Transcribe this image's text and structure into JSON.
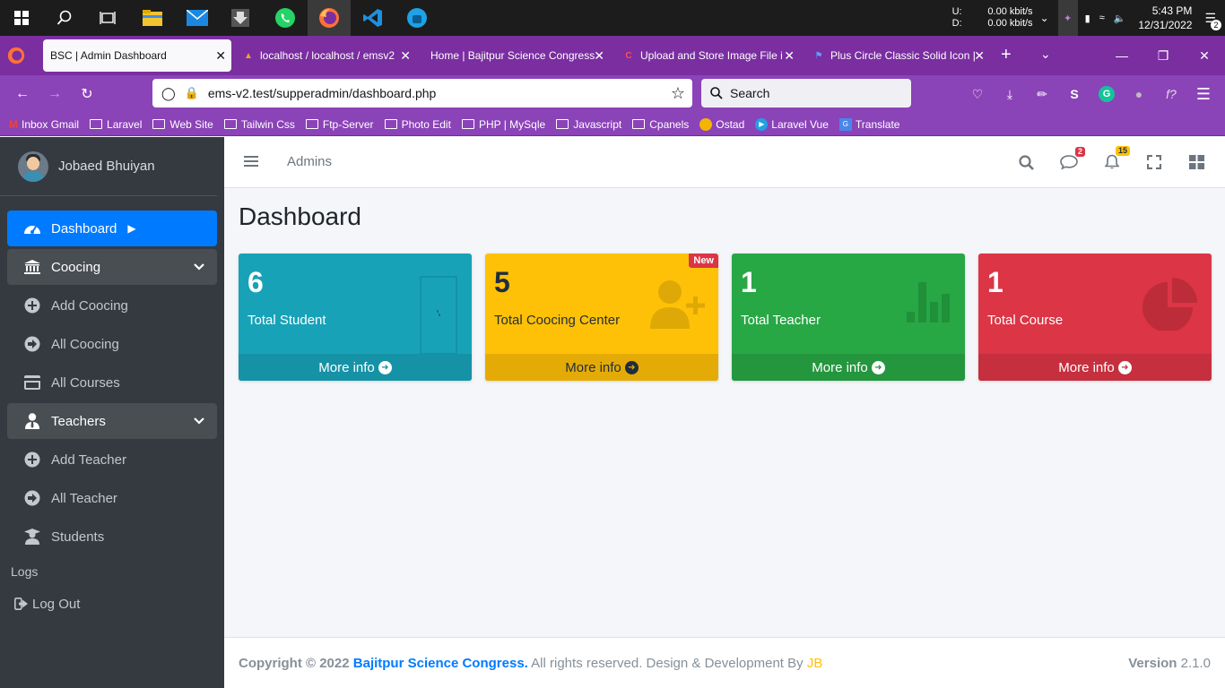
{
  "taskbar": {
    "net_up_label": "U:",
    "net_down_label": "D:",
    "net_up_value": "0.00 kbit/s",
    "net_down_value": "0.00 kbit/s",
    "time": "5:43 PM",
    "date": "12/31/2022",
    "notification_count": "2"
  },
  "browser": {
    "tabs": [
      {
        "label": "BSC | Admin Dashboard"
      },
      {
        "label": "localhost / localhost / emsv2"
      },
      {
        "label": "Home | Bajitpur Science Congress"
      },
      {
        "label": "Upload and Store Image File i"
      },
      {
        "label": "Plus Circle Classic Solid Icon |"
      }
    ],
    "url": "ems-v2.test/supperadmin/dashboard.php",
    "search_placeholder": "Search",
    "bookmarks": [
      {
        "label": "Inbox Gmail"
      },
      {
        "label": "Laravel"
      },
      {
        "label": "Web Site"
      },
      {
        "label": "Tailwin Css"
      },
      {
        "label": "Ftp-Server"
      },
      {
        "label": "Photo Edit"
      },
      {
        "label": "PHP | MySqle"
      },
      {
        "label": "Javascript"
      },
      {
        "label": "Cpanels"
      },
      {
        "label": "Ostad"
      },
      {
        "label": "Laravel Vue"
      },
      {
        "label": "Translate"
      }
    ]
  },
  "sidebar": {
    "user_name": "Jobaed Bhuiyan",
    "items": [
      {
        "label": "Dashboard"
      },
      {
        "label": "Coocing"
      },
      {
        "label": "Add Coocing"
      },
      {
        "label": "All Coocing"
      },
      {
        "label": "All Courses"
      },
      {
        "label": "Teachers"
      },
      {
        "label": "Add Teacher"
      },
      {
        "label": "All Teacher"
      },
      {
        "label": "Students"
      }
    ],
    "logs_header": "Logs",
    "logout_label": "Log Out"
  },
  "header": {
    "breadcrumb": "Admins",
    "messages_badge": "2",
    "notifications_badge": "15"
  },
  "page": {
    "title": "Dashboard",
    "cards": [
      {
        "value": "6",
        "label": "Total Student",
        "more": "More info",
        "color": "#17a2b8"
      },
      {
        "value": "5",
        "label": "Total Coocing Center",
        "more": "More info",
        "badge": "New",
        "color": "#ffc107"
      },
      {
        "value": "1",
        "label": "Total Teacher",
        "more": "More info",
        "color": "#28a745"
      },
      {
        "value": "1",
        "label": "Total Course",
        "more": "More info",
        "color": "#dc3545"
      }
    ]
  },
  "footer": {
    "copyright": "Copyright © 2022",
    "brand": "Bajitpur Science Congress.",
    "rights": "All rights reserved. Design & Development By",
    "author": "JB",
    "version_label": "Version",
    "version_value": "2.1.0"
  }
}
